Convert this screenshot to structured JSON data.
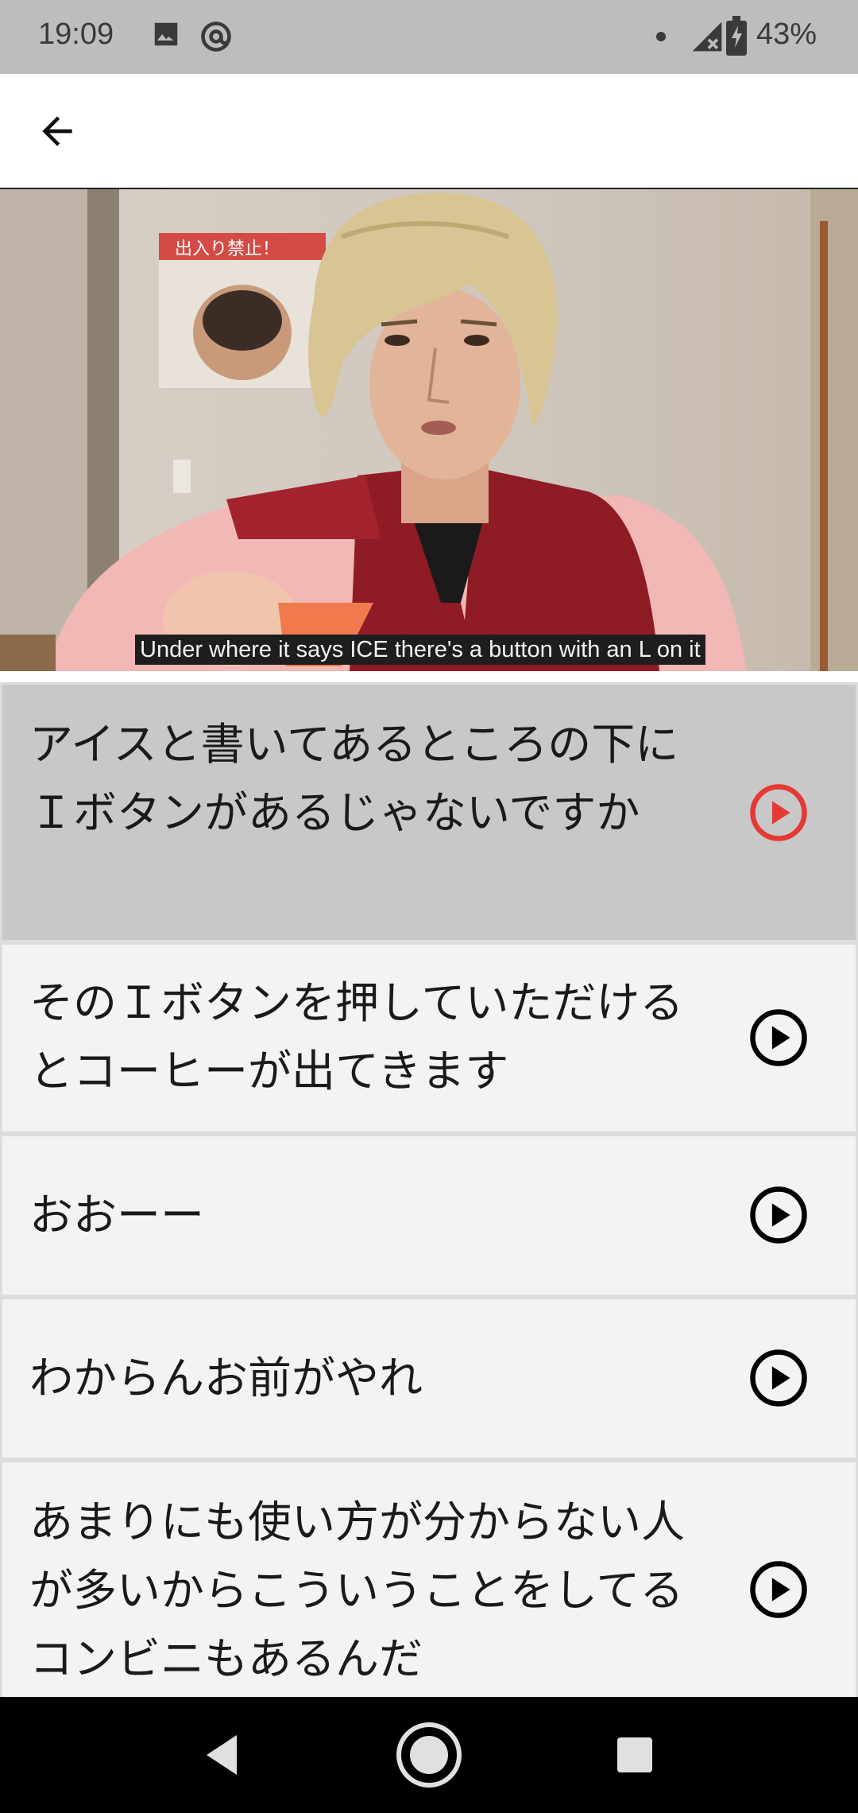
{
  "status_bar": {
    "time": "19:09",
    "icons": [
      "image-icon",
      "at-sign-icon",
      "dot-icon",
      "signal-icon",
      "battery-charging-icon"
    ],
    "battery": "43%"
  },
  "app_bar": {
    "back_icon": "arrow-left-icon"
  },
  "video": {
    "caption": "Under where it says ICE there's a button with an L on it"
  },
  "subtitles": [
    {
      "text": "アイスと書いてあるところの下にＩボタンがあるじゃないですか",
      "active": true
    },
    {
      "text": "そのＩボタンを押していただけるとコーヒーが出てきます",
      "active": false
    },
    {
      "text": "おおーー",
      "active": false
    },
    {
      "text": "わからんお前がやれ",
      "active": false
    },
    {
      "text": "あまりにも使い方が分からない人が多いからこういうことをしてるコンビニもあるんだ",
      "active": false
    }
  ],
  "colors": {
    "active_play": "#e53935",
    "play": "#000000",
    "active_row": "#c8c8c8",
    "row": "#f3f3f3"
  },
  "nav_bar": {
    "icons": [
      "back-triangle-icon",
      "home-circle-icon",
      "recents-square-icon"
    ]
  }
}
